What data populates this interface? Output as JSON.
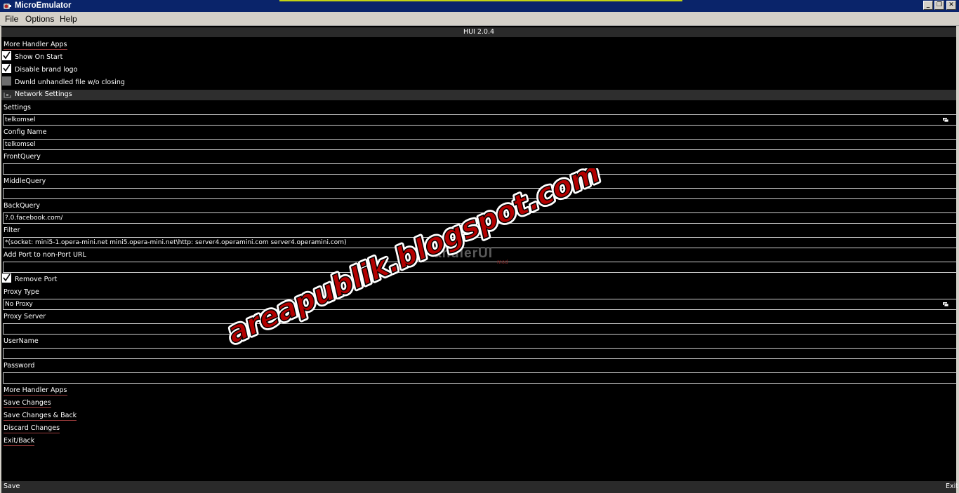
{
  "window": {
    "title": "MicroEmulator",
    "buttons": [
      "_",
      "❐",
      "✕"
    ]
  },
  "menu": {
    "items": [
      "File",
      "Options",
      "Help"
    ]
  },
  "app": {
    "header": "HUI 2.0.4",
    "more_handler_top": "More Handler Apps",
    "show_on_start": {
      "label": "Show On Start",
      "checked": true
    },
    "disable_logo": {
      "label": "Disable brand logo",
      "checked": true
    },
    "dwnld_unhandled": {
      "label": "Dwnld unhandled file w/o closing",
      "checked": false
    },
    "network_settings": "Network Settings",
    "settings": {
      "label": "Settings",
      "value": "telkomsel"
    },
    "config_name": {
      "label": "Config Name",
      "value": "telkomsel"
    },
    "front_query": {
      "label": "FrontQuery",
      "value": ""
    },
    "middle_query": {
      "label": "MiddleQuery",
      "value": ""
    },
    "back_query": {
      "label": "BackQuery",
      "value": "?.0.facebook.com/"
    },
    "filter": {
      "label": "Filter",
      "value": "*(socket: mini5-1.opera-mini.net mini5.opera-mini.net\\http: server4.operamini.com server4.operamini.com)"
    },
    "add_port": {
      "label": "Add Port to non-Port URL",
      "value": ""
    },
    "remove_port": {
      "label": "Remove Port",
      "checked": true
    },
    "proxy_type": {
      "label": "Proxy Type",
      "value": "No Proxy"
    },
    "proxy_server": {
      "label": "Proxy Server",
      "value": ""
    },
    "username": {
      "label": "UserName",
      "value": ""
    },
    "password": {
      "label": "Password",
      "value": ""
    },
    "actions": [
      "More Handler Apps",
      "Save Changes",
      "Save Changes & Back",
      "Discard Changes",
      "Exit/Back"
    ],
    "footer": {
      "left": "Save",
      "right": "Exit"
    },
    "watermark": "areapublik.blogspot.com",
    "faint_logo": "andlerUI",
    "faint_logo_sub": "mod"
  },
  "colors": {
    "titlebar": "#0a246a",
    "menubar": "#d4d0c8",
    "watermark_red": "#b30000"
  }
}
